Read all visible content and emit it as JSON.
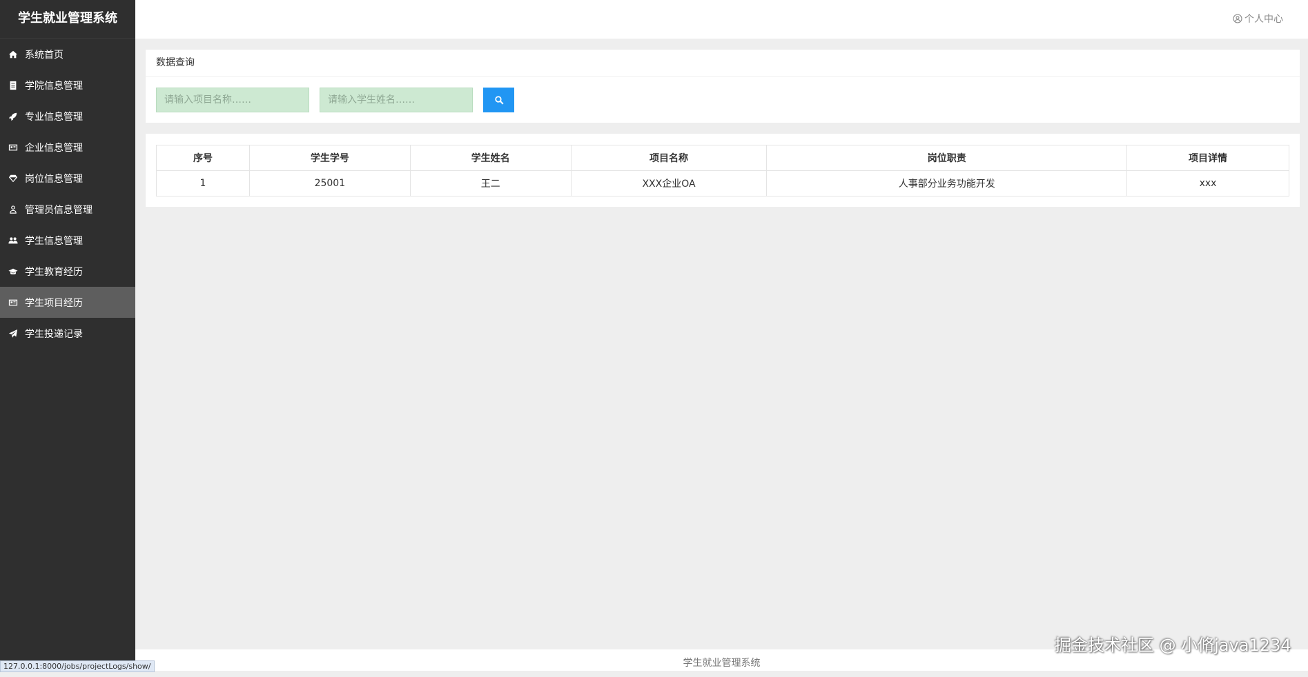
{
  "app": {
    "title": "学生就业管理系统"
  },
  "sidebar": {
    "items": [
      {
        "label": "系统首页",
        "icon": "home-icon",
        "active": false
      },
      {
        "label": "学院信息管理",
        "icon": "book-icon",
        "active": false
      },
      {
        "label": "专业信息管理",
        "icon": "rocket-icon",
        "active": false
      },
      {
        "label": "企业信息管理",
        "icon": "id-card-icon",
        "active": false
      },
      {
        "label": "岗位信息管理",
        "icon": "diamond-icon",
        "active": false
      },
      {
        "label": "管理员信息管理",
        "icon": "user-icon",
        "active": false
      },
      {
        "label": "学生信息管理",
        "icon": "users-icon",
        "active": false
      },
      {
        "label": "学生教育经历",
        "icon": "graduation-cap-icon",
        "active": false
      },
      {
        "label": "学生项目经历",
        "icon": "id-card-icon",
        "active": true
      },
      {
        "label": "学生投递记录",
        "icon": "paper-plane-icon",
        "active": false
      }
    ]
  },
  "header": {
    "user_center": "个人中心"
  },
  "search": {
    "title": "数据查询",
    "project_placeholder": "请输入项目名称……",
    "student_placeholder": "请输入学生姓名……"
  },
  "table": {
    "headers": [
      "序号",
      "学生学号",
      "学生姓名",
      "项目名称",
      "岗位职责",
      "项目详情"
    ],
    "rows": [
      [
        "1",
        "25001",
        "王二",
        "XXX企业OA",
        "人事部分业务功能开发",
        "xxx"
      ]
    ]
  },
  "footer": {
    "text": "学生就业管理系统"
  },
  "watermark": "掘金技术社区 @ 小脩java1234",
  "status_url": "127.0.0.1:8000/jobs/projectLogs/show/",
  "colors": {
    "sidebar": "#2f2f2f",
    "active": "#5e5e5e",
    "accent": "#2196f3",
    "input_bg": "#cde9d2"
  }
}
